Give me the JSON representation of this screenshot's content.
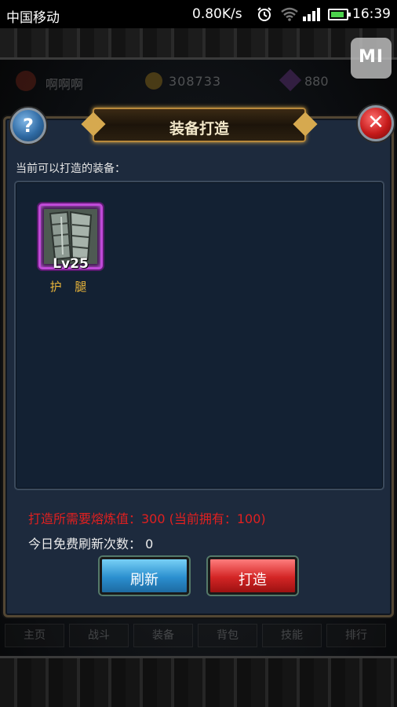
{
  "status_bar": {
    "carrier": "中国移动",
    "net_speed": "0.80K/s",
    "time": "16:39",
    "icons": [
      "alarm-icon",
      "wifi-icon",
      "signal-icon",
      "battery-icon"
    ]
  },
  "background": {
    "player_name": "啊啊啊",
    "gold": "308733",
    "gems": "880",
    "tabs": [
      "主页",
      "战斗",
      "装备",
      "背包",
      "技能",
      "排行"
    ],
    "mi_button": "MI"
  },
  "dialog": {
    "title": "装备打造",
    "help_label": "?",
    "close_label": "✕",
    "subtitle": "当前可以打造的装备：",
    "items": [
      {
        "level": "Lv25",
        "name": "护 腿",
        "rarity_color": "#c04ad8"
      }
    ],
    "cost_text": "打造所需要熔炼值：300 (当前拥有：100)",
    "free_refresh_text": "今日免费刷新次数： 0",
    "refresh_button": "刷新",
    "forge_button": "打造"
  },
  "colors": {
    "cost_red": "#e02020",
    "item_name_gold": "#e8b43a",
    "refresh_blue": "#2b8fcf",
    "forge_red": "#d32525"
  }
}
